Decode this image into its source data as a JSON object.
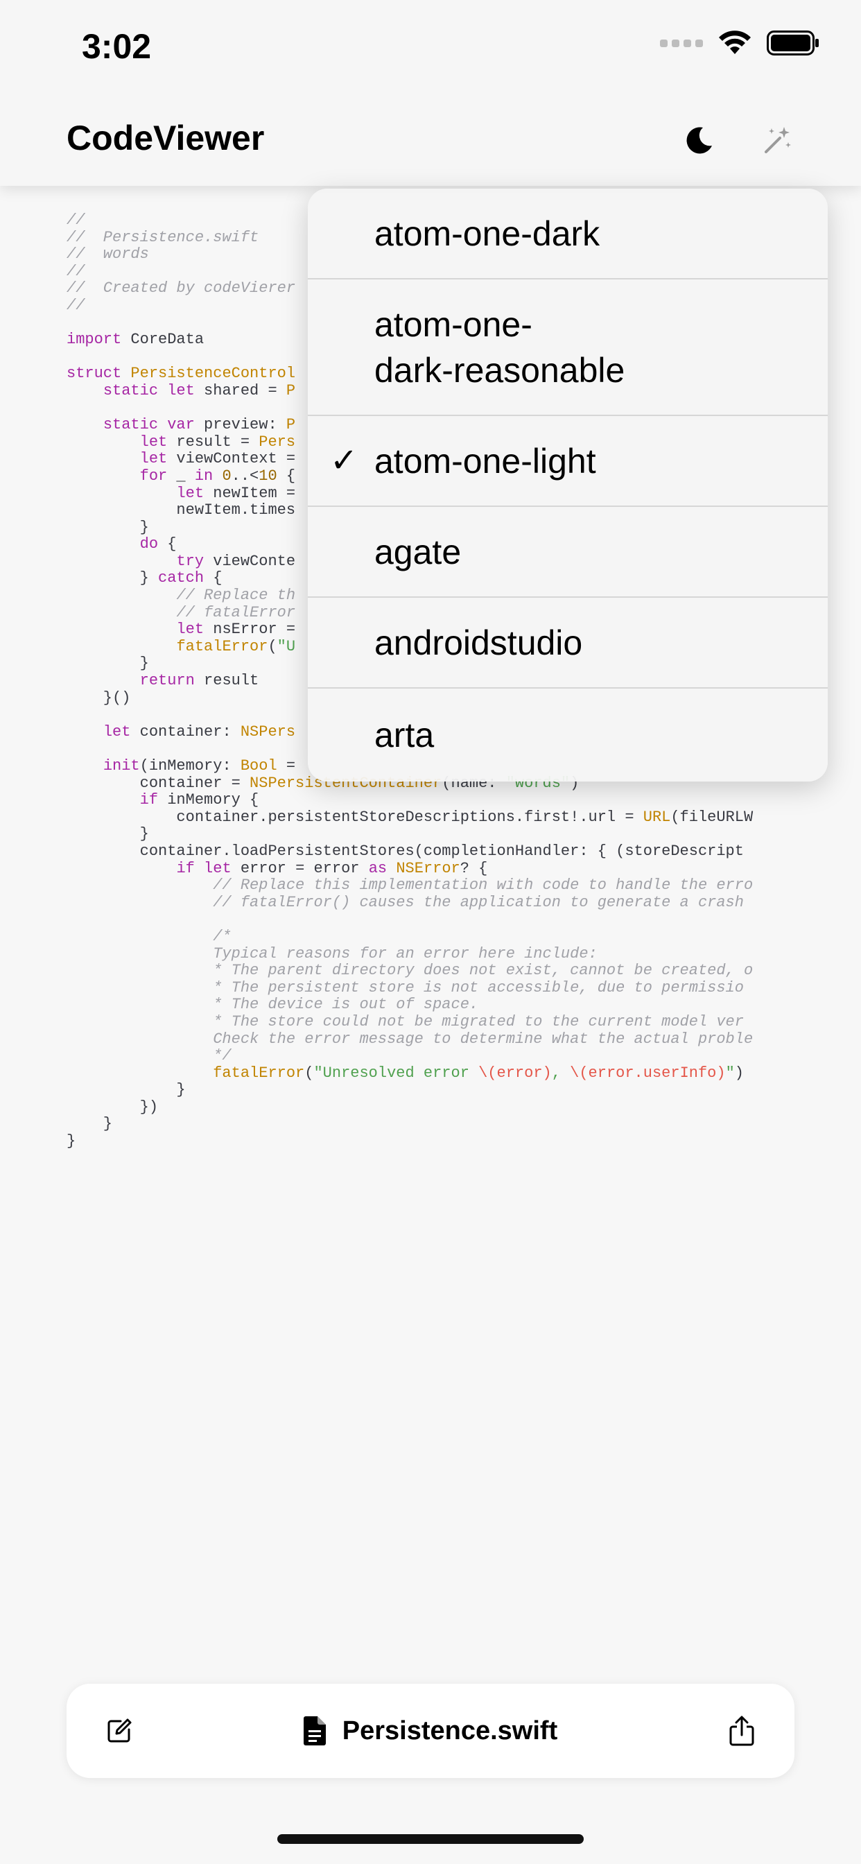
{
  "status_bar": {
    "time": "3:02"
  },
  "nav": {
    "title": "CodeViewer",
    "icons": [
      "moon-icon",
      "wand-sparkles-icon"
    ]
  },
  "menu": {
    "items": [
      {
        "label": "atom-one-dark",
        "checked": false
      },
      {
        "label": "atom-one-\ndark-reasonable",
        "checked": false
      },
      {
        "label": "atom-one-light",
        "checked": true
      },
      {
        "label": "agate",
        "checked": false
      },
      {
        "label": "androidstudio",
        "checked": false
      },
      {
        "label": "arta",
        "checked": false
      }
    ],
    "check_glyph": "✓"
  },
  "code": {
    "lines": [
      [
        [
          "c",
          "//"
        ]
      ],
      [
        [
          "c",
          "//  Persistence.swift"
        ]
      ],
      [
        [
          "c",
          "//  words"
        ]
      ],
      [
        [
          "c",
          "//"
        ]
      ],
      [
        [
          "c",
          "//  Created by codeVierer"
        ]
      ],
      [
        [
          "c",
          "//"
        ]
      ],
      [],
      [
        [
          "k",
          "import"
        ],
        [
          "p",
          " CoreData"
        ]
      ],
      [],
      [
        [
          "k",
          "struct"
        ],
        [
          "p",
          " "
        ],
        [
          "t",
          "PersistenceControl"
        ]
      ],
      [
        [
          "p",
          "    "
        ],
        [
          "k",
          "static let"
        ],
        [
          "p",
          " shared = "
        ],
        [
          "t",
          "P"
        ]
      ],
      [],
      [
        [
          "p",
          "    "
        ],
        [
          "k",
          "static var"
        ],
        [
          "p",
          " preview: "
        ],
        [
          "t",
          "P"
        ]
      ],
      [
        [
          "p",
          "        "
        ],
        [
          "k",
          "let"
        ],
        [
          "p",
          " result = "
        ],
        [
          "t",
          "Pers"
        ]
      ],
      [
        [
          "p",
          "        "
        ],
        [
          "k",
          "let"
        ],
        [
          "p",
          " viewContext ="
        ]
      ],
      [
        [
          "p",
          "        "
        ],
        [
          "k",
          "for"
        ],
        [
          "p",
          " _ "
        ],
        [
          "k",
          "in"
        ],
        [
          "p",
          " "
        ],
        [
          "n",
          "0"
        ],
        [
          "p",
          "..<"
        ],
        [
          "n",
          "10"
        ],
        [
          "p",
          " {"
        ]
      ],
      [
        [
          "p",
          "            "
        ],
        [
          "k",
          "let"
        ],
        [
          "p",
          " newItem ="
        ]
      ],
      [
        [
          "p",
          "            newItem.times"
        ]
      ],
      [
        [
          "p",
          "        }"
        ]
      ],
      [
        [
          "p",
          "        "
        ],
        [
          "k",
          "do"
        ],
        [
          "p",
          " {"
        ]
      ],
      [
        [
          "p",
          "            "
        ],
        [
          "k",
          "try"
        ],
        [
          "p",
          " viewConte"
        ]
      ],
      [
        [
          "p",
          "        } "
        ],
        [
          "k",
          "catch"
        ],
        [
          "p",
          " {"
        ]
      ],
      [
        [
          "p",
          "            "
        ],
        [
          "c",
          "// Replace th"
        ]
      ],
      [
        [
          "p",
          "            "
        ],
        [
          "c",
          "// fatalError"
        ]
      ],
      [
        [
          "p",
          "            "
        ],
        [
          "k",
          "let"
        ],
        [
          "p",
          " nsError ="
        ]
      ],
      [
        [
          "p",
          "            "
        ],
        [
          "t",
          "fatalError"
        ],
        [
          "p",
          "("
        ],
        [
          "s",
          "\"U"
        ]
      ],
      [
        [
          "p",
          "        }"
        ]
      ],
      [
        [
          "p",
          "        "
        ],
        [
          "k",
          "return"
        ],
        [
          "p",
          " result"
        ]
      ],
      [
        [
          "p",
          "    }()"
        ]
      ],
      [],
      [
        [
          "p",
          "    "
        ],
        [
          "k",
          "let"
        ],
        [
          "p",
          " container: "
        ],
        [
          "t",
          "NSPers"
        ]
      ],
      [],
      [
        [
          "p",
          "    "
        ],
        [
          "k",
          "init"
        ],
        [
          "p",
          "(inMemory: "
        ],
        [
          "t",
          "Bool"
        ],
        [
          "p",
          " ="
        ]
      ],
      [
        [
          "p",
          "        container = "
        ],
        [
          "t",
          "NSPersistentContainer"
        ],
        [
          "p",
          "(name: "
        ],
        [
          "s",
          "\"words\""
        ],
        [
          "p",
          ")"
        ]
      ],
      [
        [
          "p",
          "        "
        ],
        [
          "k",
          "if"
        ],
        [
          "p",
          " inMemory {"
        ]
      ],
      [
        [
          "p",
          "            container.persistentStoreDescriptions.first!.url = "
        ],
        [
          "t",
          "URL"
        ],
        [
          "p",
          "(fileURLW"
        ]
      ],
      [
        [
          "p",
          "        }"
        ]
      ],
      [
        [
          "p",
          "        container.loadPersistentStores(completionHandler: { (storeDescript"
        ]
      ],
      [
        [
          "p",
          "            "
        ],
        [
          "k",
          "if let"
        ],
        [
          "p",
          " error = error "
        ],
        [
          "k",
          "as"
        ],
        [
          "p",
          " "
        ],
        [
          "t",
          "NSError"
        ],
        [
          "p",
          "? {"
        ]
      ],
      [
        [
          "p",
          "                "
        ],
        [
          "c",
          "// Replace this implementation with code to handle the erro"
        ]
      ],
      [
        [
          "p",
          "                "
        ],
        [
          "c",
          "// fatalError() causes the application to generate a crash"
        ]
      ],
      [],
      [
        [
          "p",
          "                "
        ],
        [
          "c",
          "/*"
        ]
      ],
      [
        [
          "p",
          "                "
        ],
        [
          "c",
          "Typical reasons for an error here include:"
        ]
      ],
      [
        [
          "p",
          "                "
        ],
        [
          "c",
          "* The parent directory does not exist, cannot be created, o"
        ]
      ],
      [
        [
          "p",
          "                "
        ],
        [
          "c",
          "* The persistent store is not accessible, due to permissio"
        ]
      ],
      [
        [
          "p",
          "                "
        ],
        [
          "c",
          "* The device is out of space."
        ]
      ],
      [
        [
          "p",
          "                "
        ],
        [
          "c",
          "* The store could not be migrated to the current model ver"
        ]
      ],
      [
        [
          "p",
          "                "
        ],
        [
          "c",
          "Check the error message to determine what the actual proble"
        ]
      ],
      [
        [
          "p",
          "                "
        ],
        [
          "c",
          "*/"
        ]
      ],
      [
        [
          "p",
          "                "
        ],
        [
          "t",
          "fatalError"
        ],
        [
          "p",
          "("
        ],
        [
          "s",
          "\"Unresolved error "
        ],
        [
          "r",
          "\\(error)"
        ],
        [
          "s",
          ", "
        ],
        [
          "r",
          "\\(error.userInfo)"
        ],
        [
          "s",
          "\""
        ],
        [
          "p",
          ")"
        ]
      ],
      [
        [
          "p",
          "            }"
        ]
      ],
      [
        [
          "p",
          "        })"
        ]
      ],
      [
        [
          "p",
          "    }"
        ]
      ],
      [
        [
          "p",
          "}"
        ]
      ]
    ]
  },
  "toolbar": {
    "filename": "Persistence.swift",
    "icons": [
      "edit-icon",
      "document-icon",
      "share-icon"
    ]
  },
  "colors": {
    "keyword": "#a626a4",
    "type": "#c18401",
    "number": "#986801",
    "string": "#50a14f",
    "interpolation": "#e45649",
    "comment": "#a0a1a7",
    "plain": "#383a42"
  }
}
